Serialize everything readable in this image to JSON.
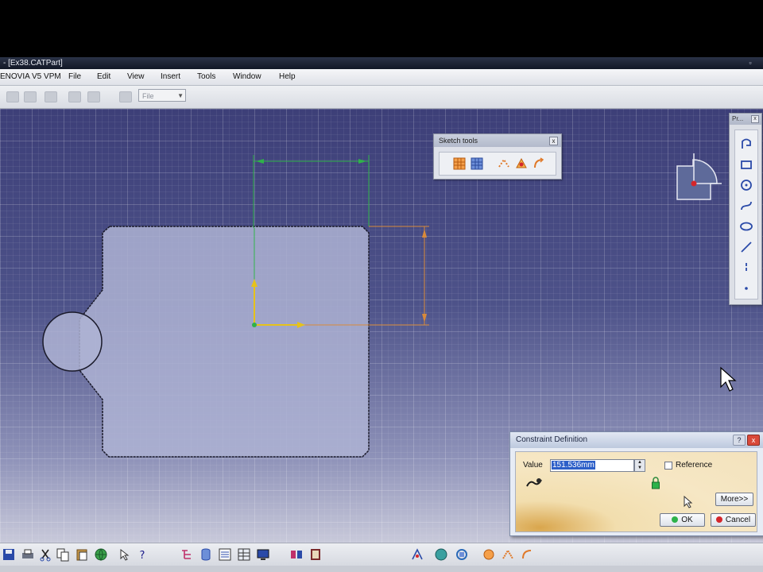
{
  "window": {
    "title": "- [Ex38.CATPart]"
  },
  "menubar": {
    "app": "ENOVIA V5 VPM",
    "items": [
      "File",
      "Edit",
      "View",
      "Insert",
      "Tools",
      "Window",
      "Help"
    ]
  },
  "toolbar_top": {
    "file_select_value": "File"
  },
  "sketch_tools": {
    "title": "Sketch tools",
    "close": "x"
  },
  "palette": {
    "title": "Pr..."
  },
  "constraint_dialog": {
    "title": "Constraint Definition",
    "value_label": "Value",
    "value": "151.536mm",
    "reference_label": "Reference",
    "more_button": "More>>",
    "ok_button": "OK",
    "cancel_button": "Cancel",
    "help_btn": "?",
    "close_btn": "x"
  },
  "colors": {
    "viewport_bg": "#4a4f84",
    "profile_fill": "#aeb3d4",
    "dimension_orange": "#d88a3a",
    "axis_green": "#2fb24a",
    "axis_yellow": "#e6c21a",
    "ok_green": "#2db24a",
    "cancel_red": "#d4262b"
  }
}
